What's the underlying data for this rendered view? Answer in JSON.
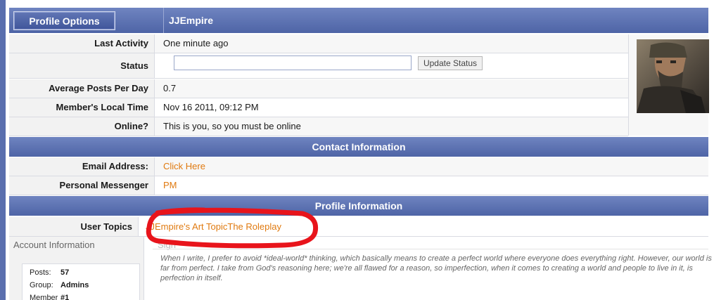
{
  "header": {
    "profile_options": "Profile Options",
    "username": "JJEmpire"
  },
  "info_rows": {
    "last_activity": {
      "label": "Last Activity",
      "value": "One minute ago"
    },
    "status": {
      "label": "Status",
      "input_value": "",
      "button": "Update Status"
    },
    "avg_posts": {
      "label": "Average Posts Per Day",
      "value": "0.7"
    },
    "local_time": {
      "label": "Member's Local Time",
      "value": "Nov 16 2011, 09:12 PM"
    },
    "online": {
      "label": "Online?",
      "value": "This is you, so you must be online"
    }
  },
  "contact": {
    "title": "Contact Information",
    "email": {
      "label": "Email Address:",
      "value": "Click Here"
    },
    "messenger": {
      "label": "Personal Messenger",
      "value": "PM"
    }
  },
  "profile_info": {
    "title": "Profile Information",
    "user_topics": {
      "label": "User Topics",
      "topic1": "JJEmpire's Art Topic",
      "topic2": "The Roleplay"
    }
  },
  "account": {
    "title": "Account Information",
    "posts": {
      "label": "Posts:",
      "value": "57"
    },
    "group": {
      "label": "Group:",
      "value": "Admins"
    },
    "member": {
      "label": "Member",
      "value": "#1"
    }
  },
  "signature": {
    "label": "Sign",
    "text": "When I write, I prefer to avoid *ideal-world* thinking, which basically means to create a perfect world where everyone does everything right. However, our world is far from perfect. I take from God's reasoning here; we're all flawed for a reason, so imperfection, when it comes to creating a world and people to live in it, is perfection in itself."
  },
  "colors": {
    "header_blue": "#5a6fae",
    "link_orange": "#e07a10",
    "annotation_red": "#e8141b"
  },
  "icons": {
    "avatar": "soldier-avatar"
  }
}
